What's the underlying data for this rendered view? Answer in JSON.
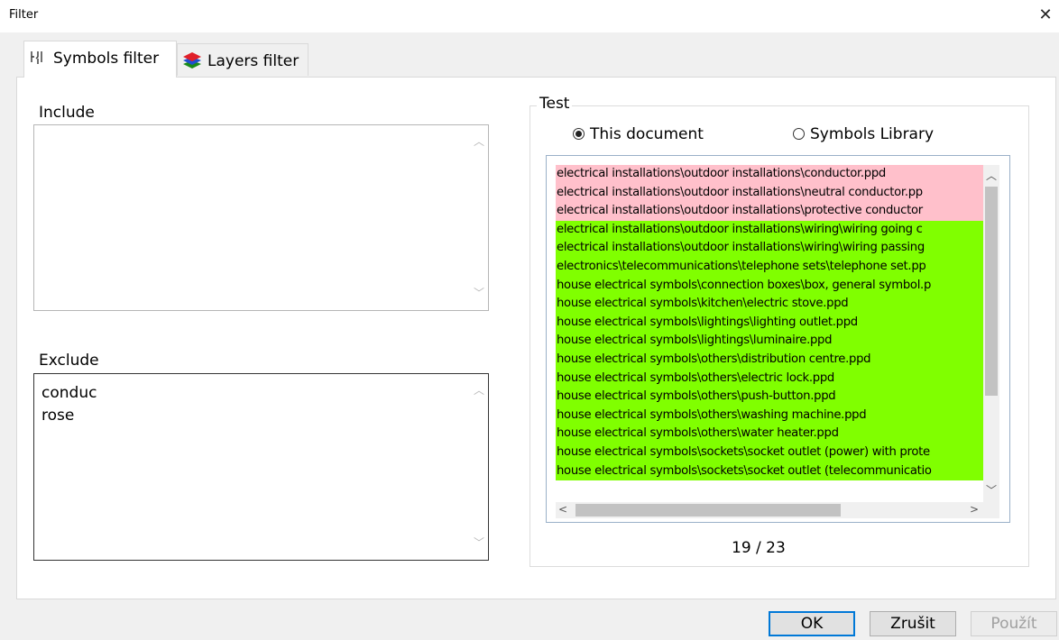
{
  "window": {
    "title": "Filter",
    "close_label": "✕"
  },
  "tabs": [
    {
      "label": "Symbols filter",
      "icon": "symbol-icon",
      "active": true
    },
    {
      "label": "Layers filter",
      "icon": "layers-icon",
      "active": false
    }
  ],
  "include": {
    "label": "Include",
    "lines": []
  },
  "exclude": {
    "label": "Exclude",
    "lines": [
      "conduc",
      "rose"
    ]
  },
  "test": {
    "caption": "Test",
    "radio_this_document": "This document",
    "radio_symbols_library": "Symbols Library",
    "selected": "This document",
    "items": [
      {
        "text": "electrical installations\\outdoor installations\\conductor.ppd",
        "status": "excluded"
      },
      {
        "text": "electrical installations\\outdoor installations\\neutral conductor.pp",
        "status": "excluded"
      },
      {
        "text": "electrical installations\\outdoor installations\\protective conductor",
        "status": "excluded"
      },
      {
        "text": "electrical installations\\outdoor installations\\wiring\\wiring going c",
        "status": "included"
      },
      {
        "text": "electrical installations\\outdoor installations\\wiring\\wiring passing",
        "status": "included"
      },
      {
        "text": "electronics\\telecommunications\\telephone sets\\telephone set.pp",
        "status": "included"
      },
      {
        "text": "house electrical symbols\\connection boxes\\box, general symbol.p",
        "status": "included"
      },
      {
        "text": "house electrical symbols\\kitchen\\electric stove.ppd",
        "status": "included"
      },
      {
        "text": "house electrical symbols\\lightings\\lighting outlet.ppd",
        "status": "included"
      },
      {
        "text": "house electrical symbols\\lightings\\luminaire.ppd",
        "status": "included"
      },
      {
        "text": "house electrical symbols\\others\\distribution centre.ppd",
        "status": "included"
      },
      {
        "text": "house electrical symbols\\others\\electric lock.ppd",
        "status": "included"
      },
      {
        "text": "house electrical symbols\\others\\push-button.ppd",
        "status": "included"
      },
      {
        "text": "house electrical symbols\\others\\washing machine.ppd",
        "status": "included"
      },
      {
        "text": "house electrical symbols\\others\\water heater.ppd",
        "status": "included"
      },
      {
        "text": "house electrical symbols\\sockets\\socket outlet (power) with prote",
        "status": "included"
      },
      {
        "text": "house electrical symbols\\sockets\\socket outlet (telecommunicatio",
        "status": "included"
      }
    ],
    "count_text": "19 / 23"
  },
  "colors": {
    "excluded": "#ffc0cb",
    "included": "#80ff00",
    "accent": "#0078d7"
  },
  "buttons": {
    "ok": "OK",
    "cancel": "Zrušit",
    "apply": "Použít"
  }
}
